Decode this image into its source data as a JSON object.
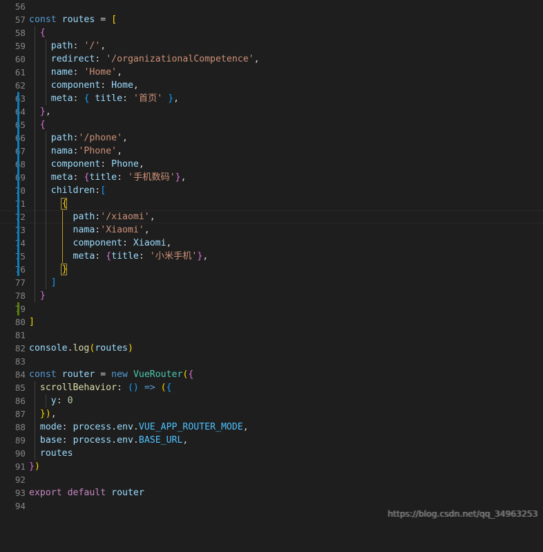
{
  "editor": {
    "theme": "dark-plus",
    "background": "#1e1e1e",
    "line_number_color": "#858585",
    "first_line": 56,
    "last_line": 94,
    "current_line": 72,
    "modified_gutter_color": "#0c7cbd",
    "added_gutter_color": "#587c0c"
  },
  "watermark": {
    "text": "https://blog.csdn.net/qq_34963253"
  },
  "lines": [
    {
      "n": "56",
      "text": ""
    },
    {
      "n": "57",
      "text": "const routes = ["
    },
    {
      "n": "58",
      "text": "  {"
    },
    {
      "n": "59",
      "text": "    path: '/',"
    },
    {
      "n": "60",
      "text": "    redirect: '/organizationalCompetence',"
    },
    {
      "n": "61",
      "text": "    name: 'Home',"
    },
    {
      "n": "62",
      "text": "    component: Home,"
    },
    {
      "n": "63",
      "text": "    meta: { title: '首页' },"
    },
    {
      "n": "64",
      "text": "  },"
    },
    {
      "n": "65",
      "text": "  {"
    },
    {
      "n": "66",
      "text": "    path:'/phone',"
    },
    {
      "n": "67",
      "text": "    nama:'Phone',"
    },
    {
      "n": "68",
      "text": "    component: Phone,"
    },
    {
      "n": "69",
      "text": "    meta: {title: '手机数码'},"
    },
    {
      "n": "70",
      "text": "    children:["
    },
    {
      "n": "71",
      "text": "      {"
    },
    {
      "n": "72",
      "text": "        path:'/xiaomi',"
    },
    {
      "n": "73",
      "text": "        nama:'Xiaomi',"
    },
    {
      "n": "74",
      "text": "        component: Xiaomi,"
    },
    {
      "n": "75",
      "text": "        meta: {title: '小米手机'},"
    },
    {
      "n": "76",
      "text": "      }"
    },
    {
      "n": "77",
      "text": "    ]"
    },
    {
      "n": "78",
      "text": "  }"
    },
    {
      "n": "79",
      "text": ""
    },
    {
      "n": "80",
      "text": "]"
    },
    {
      "n": "81",
      "text": ""
    },
    {
      "n": "82",
      "text": "console.log(routes)"
    },
    {
      "n": "83",
      "text": ""
    },
    {
      "n": "84",
      "text": "const router = new VueRouter({"
    },
    {
      "n": "85",
      "text": "  scrollBehavior: () => ({"
    },
    {
      "n": "86",
      "text": "    y: 0"
    },
    {
      "n": "87",
      "text": "  }),"
    },
    {
      "n": "88",
      "text": "  mode: process.env.VUE_APP_ROUTER_MODE,"
    },
    {
      "n": "89",
      "text": "  base: process.env.BASE_URL,"
    },
    {
      "n": "90",
      "text": "  routes"
    },
    {
      "n": "91",
      "text": "})"
    },
    {
      "n": "92",
      "text": ""
    },
    {
      "n": "93",
      "text": "export default router"
    },
    {
      "n": "94",
      "text": ""
    }
  ]
}
